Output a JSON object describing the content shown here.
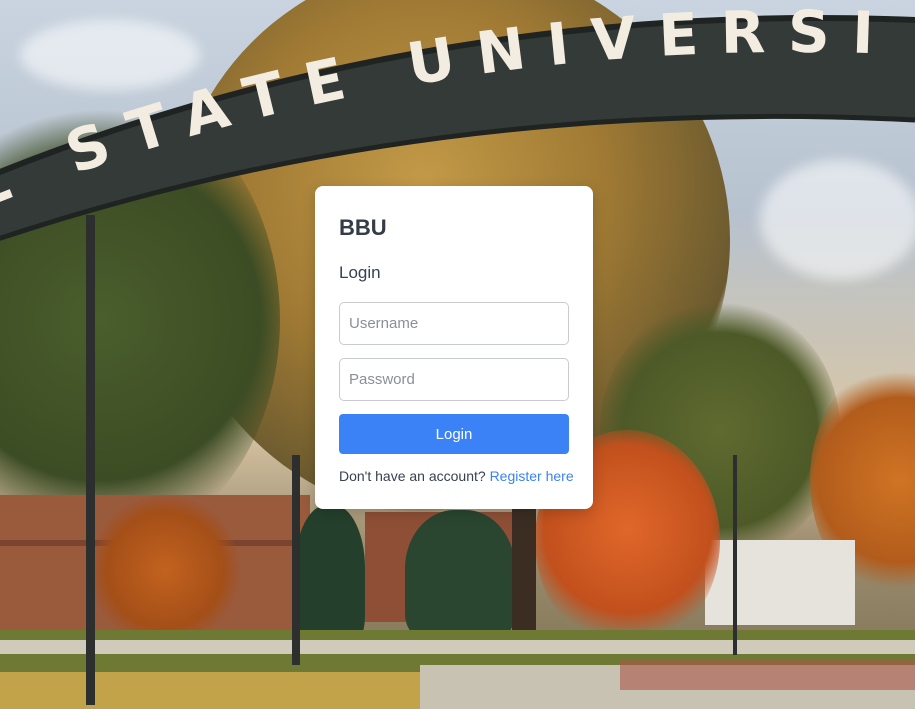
{
  "background": {
    "arch_text": "L STATE UNIVERSI"
  },
  "card": {
    "brand": "BBU",
    "heading": "Login",
    "username_placeholder": "Username",
    "password_placeholder": "Password",
    "login_button": "Login",
    "register_prompt": "Don't have an account?",
    "register_link": "Register here"
  },
  "colors": {
    "primary": "#3b82f6",
    "card_bg": "#ffffff",
    "heading_text": "#343c47"
  }
}
